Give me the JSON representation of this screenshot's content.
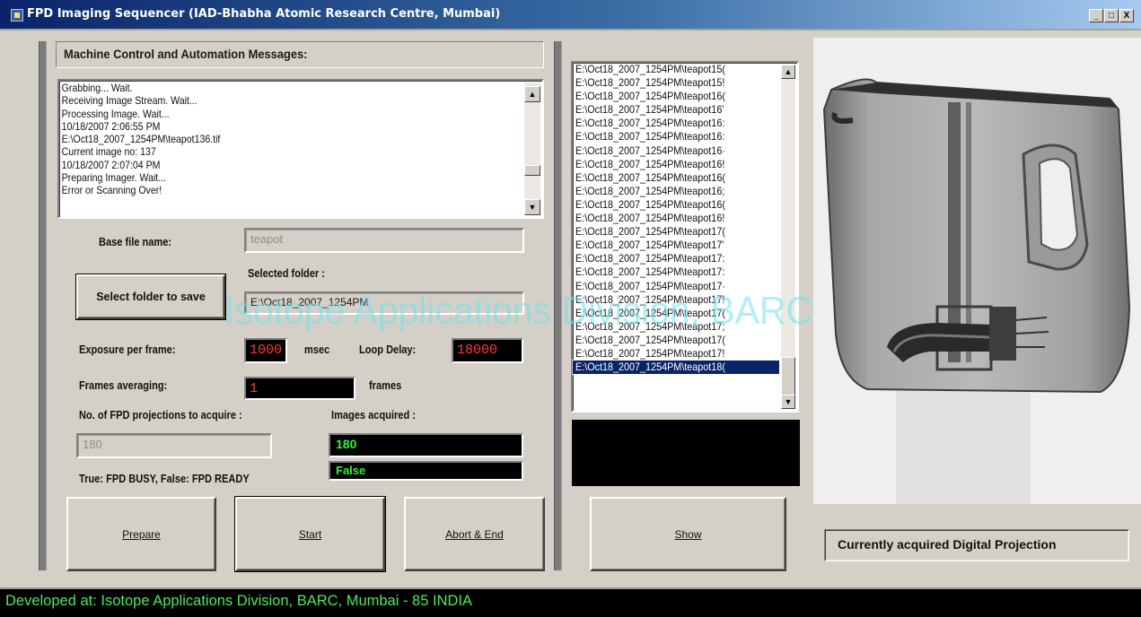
{
  "window": {
    "title": "FPD Imaging Sequencer (IAD-Bhabha Atomic Research Centre, Mumbai)",
    "controls": {
      "minimize": "_",
      "maximize": "□",
      "close": "X"
    }
  },
  "messages": {
    "header": "Machine Control  and Automation Messages:",
    "lines": [
      "Grabbing... Wait.",
      "Receiving Image Stream. Wait...",
      "Processing Image. Wait...",
      "10/18/2007 2:06:55 PM",
      "E:\\Oct18_2007_1254PM\\teapot136.tif",
      "Current image no: 137",
      "10/18/2007 2:07:04 PM",
      "Preparing Imager. Wait...",
      "Error or Scanning Over!"
    ]
  },
  "form": {
    "base_file_label": "Base file name:",
    "base_file_value": "teapot",
    "selected_folder_label": "Selected folder :",
    "select_folder_button": "Select folder to save",
    "selected_folder_value": "E:\\Oct18_2007_1254PM",
    "exposure_label": "Exposure per frame:",
    "exposure_value": "1000",
    "exposure_unit": "msec",
    "loop_delay_label": "Loop Delay:",
    "loop_delay_value": "18000",
    "frames_avg_label": "Frames averaging:",
    "frames_avg_value": "1",
    "frames_unit": "frames",
    "projections_label": "No. of FPD projections to acquire :",
    "projections_value": "180",
    "images_acquired_label": "Images acquired :",
    "images_acquired_value": "180",
    "busy_label": "True: FPD BUSY, False: FPD READY",
    "busy_value": "False"
  },
  "buttons": {
    "prepare": "Prepare",
    "start": "Start",
    "abort": "Abort & End",
    "show": "Show"
  },
  "file_list": {
    "items": [
      "E:\\Oct18_2007_1254PM\\teapot15(",
      "E:\\Oct18_2007_1254PM\\teapot15!",
      "E:\\Oct18_2007_1254PM\\teapot16(",
      "E:\\Oct18_2007_1254PM\\teapot16'",
      "E:\\Oct18_2007_1254PM\\teapot16:",
      "E:\\Oct18_2007_1254PM\\teapot16:",
      "E:\\Oct18_2007_1254PM\\teapot16·",
      "E:\\Oct18_2007_1254PM\\teapot16!",
      "E:\\Oct18_2007_1254PM\\teapot16(",
      "E:\\Oct18_2007_1254PM\\teapot16;",
      "E:\\Oct18_2007_1254PM\\teapot16(",
      "E:\\Oct18_2007_1254PM\\teapot16!",
      "E:\\Oct18_2007_1254PM\\teapot17(",
      "E:\\Oct18_2007_1254PM\\teapot17'",
      "E:\\Oct18_2007_1254PM\\teapot17:",
      "E:\\Oct18_2007_1254PM\\teapot17:",
      "E:\\Oct18_2007_1254PM\\teapot17·",
      "E:\\Oct18_2007_1254PM\\teapot17!",
      "E:\\Oct18_2007_1254PM\\teapot17(",
      "E:\\Oct18_2007_1254PM\\teapot17;",
      "E:\\Oct18_2007_1254PM\\teapot17(",
      "E:\\Oct18_2007_1254PM\\teapot17!",
      "E:\\Oct18_2007_1254PM\\teapot18("
    ],
    "selected_index": 22
  },
  "image_panel": {
    "caption": "Currently acquired Digital Projection"
  },
  "watermark": "Isotope Applications Division, BARC",
  "status_bar": "Developed at: Isotope Applications Division, BARC, Mumbai - 85 INDIA",
  "colors": {
    "title_gradient_start": "#0a246a",
    "lcd_red": "#ff3a3a",
    "lcd_green": "#34f03a",
    "status_green": "#4aea5a",
    "selection": "#0a246a"
  }
}
